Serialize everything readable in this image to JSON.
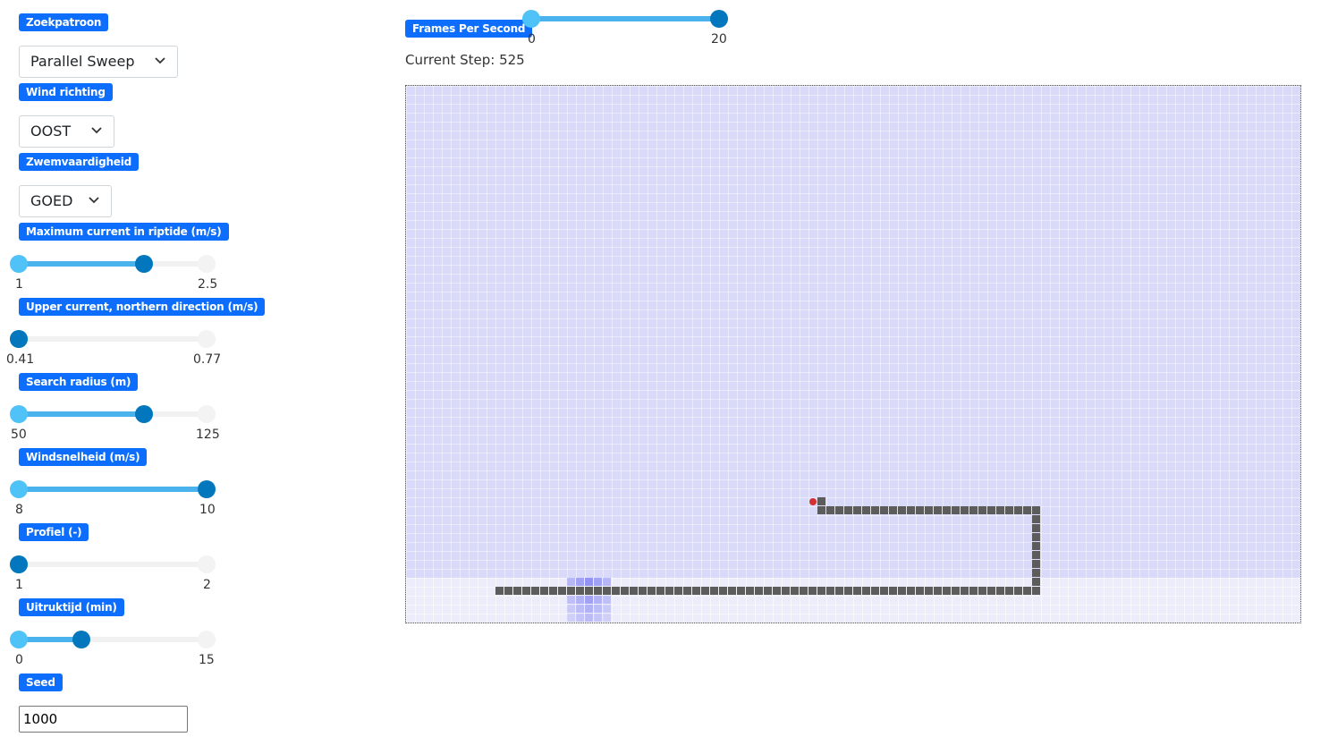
{
  "controls": {
    "zoekpatroon": {
      "label": "Zoekpatroon",
      "value": "Parallel Sweep"
    },
    "wind_richting": {
      "label": "Wind richting",
      "value": "OOST"
    },
    "zwemvaardigheid": {
      "label": "Zwemvaardigheid",
      "value": "GOED"
    },
    "max_current": {
      "label": "Maximum current in riptide (m/s)",
      "min": "1",
      "max": "2.5",
      "fill_fraction": 0.667
    },
    "upper_current": {
      "label": "Upper current, northern direction (m/s)",
      "min": "0.41",
      "max": "0.77",
      "fill_fraction": 0.0
    },
    "search_radius": {
      "label": "Search radius (m)",
      "min": "50",
      "max": "125",
      "fill_fraction": 0.667
    },
    "windsnelheid": {
      "label": "Windsnelheid (m/s)",
      "min": "8",
      "max": "10",
      "fill_fraction": 1.0
    },
    "profiel": {
      "label": "Profiel (-)",
      "min": "1",
      "max": "2",
      "fill_fraction": 0.0
    },
    "uitruktijd": {
      "label": "Uitruktijd (min)",
      "min": "0",
      "max": "15",
      "fill_fraction": 0.333
    },
    "seed": {
      "label": "Seed",
      "value": "1000"
    }
  },
  "fps": {
    "label": "Frames Per Second",
    "min": "0",
    "max": "20",
    "fill_fraction": 1.0
  },
  "step": {
    "text": "Current Step: 525"
  },
  "colors": {
    "badge": "#0d6efd",
    "sea": "#d9d9fa",
    "beach": "#ececfb",
    "path": "#5c5c5c",
    "swimmer": "#d32f2f",
    "rip_current": "#8a8af2"
  },
  "icons": {
    "dropdown": "chevron-down-icon"
  }
}
